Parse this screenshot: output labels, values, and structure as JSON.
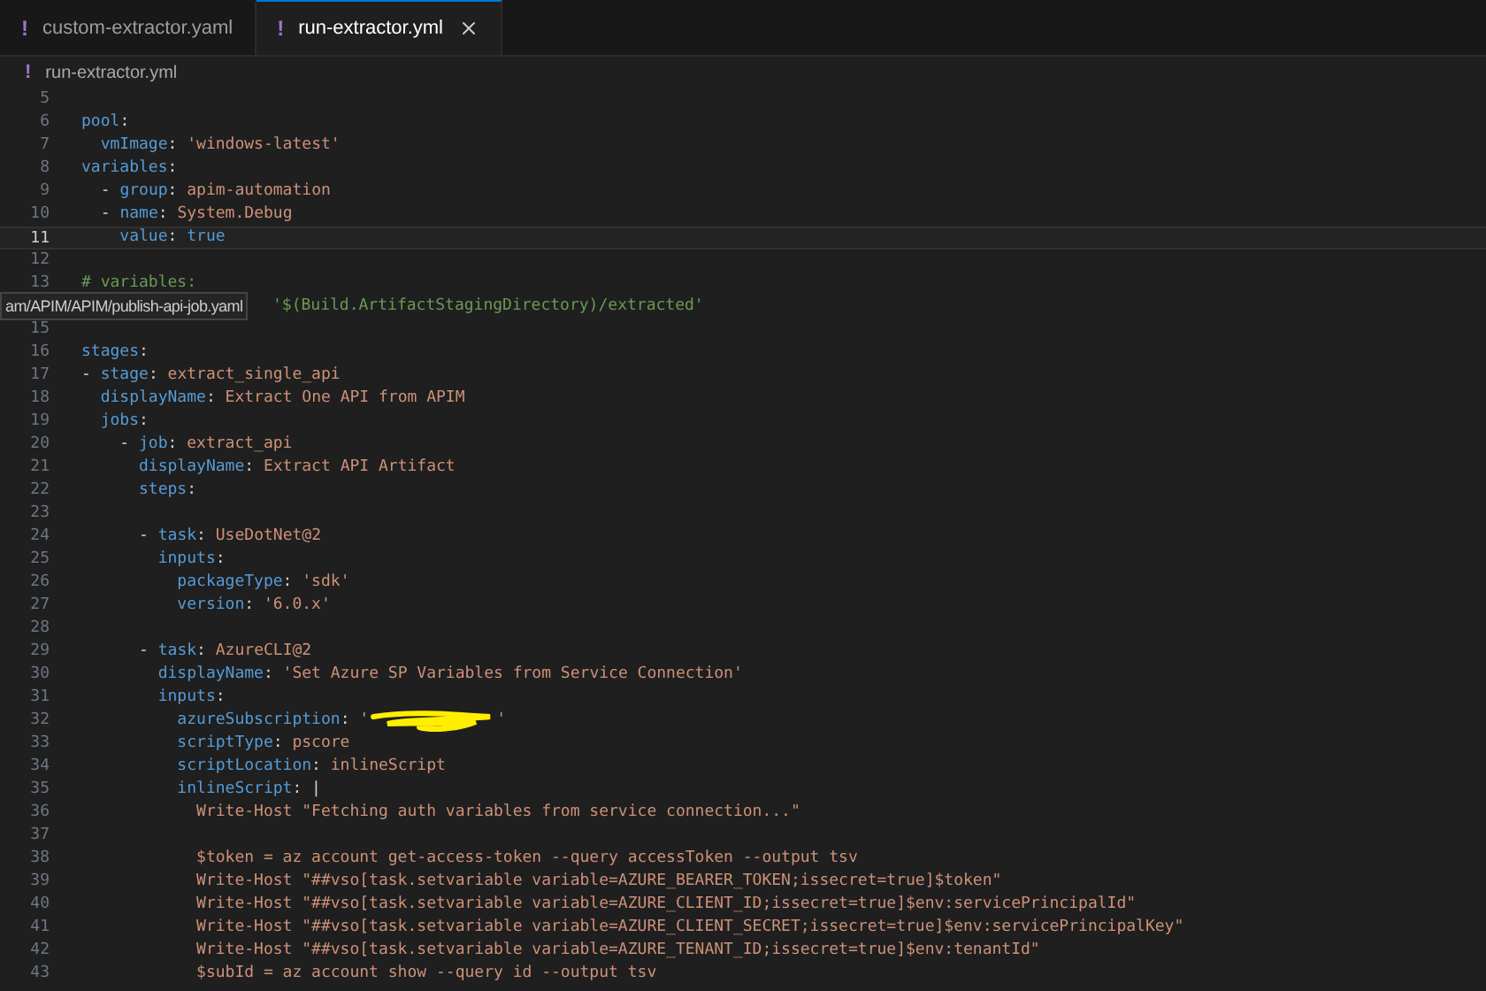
{
  "tabs": [
    {
      "icon": "!",
      "label": "custom-extractor.yaml",
      "selected": false
    },
    {
      "icon": "!",
      "label": "run-extractor.yml",
      "selected": true
    }
  ],
  "breadcrumb": {
    "icon": "!",
    "label": "run-extractor.yml"
  },
  "tooltip": "am/APIM/APIM/publish-api-job.yaml",
  "lines": [
    {
      "n": "5",
      "current": false
    },
    {
      "n": "6",
      "current": false,
      "tokens": [
        {
          "kind": "key",
          "text": "pool"
        },
        {
          "kind": "plain",
          "text": ":"
        }
      ]
    },
    {
      "n": "7",
      "current": false,
      "tokens": [
        {
          "kind": "key",
          "text": "  vmImage"
        },
        {
          "kind": "plain",
          "text": ": "
        },
        {
          "kind": "str",
          "text": "'windows-latest'"
        }
      ]
    },
    {
      "n": "8",
      "current": false,
      "tokens": [
        {
          "kind": "key",
          "text": "variables"
        },
        {
          "kind": "plain",
          "text": ":"
        }
      ]
    },
    {
      "n": "9",
      "current": false,
      "tokens": [
        {
          "kind": "plain",
          "text": "  - "
        },
        {
          "kind": "key",
          "text": "group"
        },
        {
          "kind": "plain",
          "text": ": "
        },
        {
          "kind": "str",
          "text": "apim-automation"
        }
      ]
    },
    {
      "n": "10",
      "current": false,
      "tokens": [
        {
          "kind": "plain",
          "text": "  - "
        },
        {
          "kind": "key",
          "text": "name"
        },
        {
          "kind": "plain",
          "text": ": "
        },
        {
          "kind": "str",
          "text": "System.Debug"
        }
      ]
    },
    {
      "n": "11",
      "current": true,
      "tokens": [
        {
          "kind": "key",
          "text": "    value"
        },
        {
          "kind": "plain",
          "text": ": "
        },
        {
          "kind": "bool",
          "text": "true"
        }
      ]
    },
    {
      "n": "12",
      "current": false
    },
    {
      "n": "13",
      "current": false,
      "tokens": [
        {
          "kind": "comment",
          "text": "# variables:"
        }
      ]
    },
    {
      "current": false,
      "covered": true,
      "tokens": [
        {
          "kind": "comment",
          "text": "'$(Build.ArtifactStagingDirectory)/extracted'"
        }
      ]
    },
    {
      "n": "15",
      "current": false
    },
    {
      "n": "16",
      "current": false,
      "tokens": [
        {
          "kind": "key",
          "text": "stages"
        },
        {
          "kind": "plain",
          "text": ":"
        }
      ]
    },
    {
      "n": "17",
      "current": false,
      "tokens": [
        {
          "kind": "plain",
          "text": "- "
        },
        {
          "kind": "key",
          "text": "stage"
        },
        {
          "kind": "plain",
          "text": ": "
        },
        {
          "kind": "str",
          "text": "extract_single_api"
        }
      ]
    },
    {
      "n": "18",
      "current": false,
      "tokens": [
        {
          "kind": "key",
          "text": "  displayName"
        },
        {
          "kind": "plain",
          "text": ": "
        },
        {
          "kind": "str",
          "text": "Extract One API from APIM"
        }
      ]
    },
    {
      "n": "19",
      "current": false,
      "tokens": [
        {
          "kind": "key",
          "text": "  jobs"
        },
        {
          "kind": "plain",
          "text": ":"
        }
      ]
    },
    {
      "n": "20",
      "current": false,
      "tokens": [
        {
          "kind": "plain",
          "text": "    - "
        },
        {
          "kind": "key",
          "text": "job"
        },
        {
          "kind": "plain",
          "text": ": "
        },
        {
          "kind": "str",
          "text": "extract_api"
        }
      ]
    },
    {
      "n": "21",
      "current": false,
      "tokens": [
        {
          "kind": "key",
          "text": "      displayName"
        },
        {
          "kind": "plain",
          "text": ": "
        },
        {
          "kind": "str",
          "text": "Extract API Artifact"
        }
      ]
    },
    {
      "n": "22",
      "current": false,
      "tokens": [
        {
          "kind": "key",
          "text": "      steps"
        },
        {
          "kind": "plain",
          "text": ":"
        }
      ]
    },
    {
      "n": "23",
      "current": false
    },
    {
      "n": "24",
      "current": false,
      "tokens": [
        {
          "kind": "plain",
          "text": "      - "
        },
        {
          "kind": "key",
          "text": "task"
        },
        {
          "kind": "plain",
          "text": ": "
        },
        {
          "kind": "str",
          "text": "UseDotNet@2"
        }
      ]
    },
    {
      "n": "25",
      "current": false,
      "tokens": [
        {
          "kind": "key",
          "text": "        inputs"
        },
        {
          "kind": "plain",
          "text": ":"
        }
      ]
    },
    {
      "n": "26",
      "current": false,
      "tokens": [
        {
          "kind": "key",
          "text": "          packageType"
        },
        {
          "kind": "plain",
          "text": ": "
        },
        {
          "kind": "str",
          "text": "'sdk'"
        }
      ]
    },
    {
      "n": "27",
      "current": false,
      "tokens": [
        {
          "kind": "key",
          "text": "          version"
        },
        {
          "kind": "plain",
          "text": ": "
        },
        {
          "kind": "str",
          "text": "'6.0.x'"
        }
      ]
    },
    {
      "n": "28",
      "current": false
    },
    {
      "n": "29",
      "current": false,
      "tokens": [
        {
          "kind": "plain",
          "text": "      - "
        },
        {
          "kind": "key",
          "text": "task"
        },
        {
          "kind": "plain",
          "text": ": "
        },
        {
          "kind": "str",
          "text": "AzureCLI@2"
        }
      ]
    },
    {
      "n": "30",
      "current": false,
      "tokens": [
        {
          "kind": "key",
          "text": "        displayName"
        },
        {
          "kind": "plain",
          "text": ": "
        },
        {
          "kind": "str",
          "text": "'Set Azure SP Variables from Service Connection'"
        }
      ]
    },
    {
      "n": "31",
      "current": false,
      "tokens": [
        {
          "kind": "key",
          "text": "        inputs"
        },
        {
          "kind": "plain",
          "text": ":"
        }
      ]
    },
    {
      "n": "32",
      "current": false,
      "tokens": [
        {
          "kind": "key",
          "text": "          azureSubscription"
        },
        {
          "kind": "plain",
          "text": ": "
        },
        {
          "kind": "str",
          "text": "'"
        },
        {
          "kind": "redaction"
        },
        {
          "kind": "str",
          "text": "'"
        }
      ]
    },
    {
      "n": "33",
      "current": false,
      "tokens": [
        {
          "kind": "key",
          "text": "          scriptType"
        },
        {
          "kind": "plain",
          "text": ": "
        },
        {
          "kind": "str",
          "text": "pscore"
        }
      ]
    },
    {
      "n": "34",
      "current": false,
      "tokens": [
        {
          "kind": "key",
          "text": "          scriptLocation"
        },
        {
          "kind": "plain",
          "text": ": "
        },
        {
          "kind": "str",
          "text": "inlineScript"
        }
      ]
    },
    {
      "n": "35",
      "current": false,
      "tokens": [
        {
          "kind": "key",
          "text": "          inlineScript"
        },
        {
          "kind": "plain",
          "text": ": |"
        }
      ]
    },
    {
      "n": "36",
      "current": false,
      "tokens": [
        {
          "kind": "str",
          "text": "            Write-Host \"Fetching auth variables from service connection...\""
        }
      ]
    },
    {
      "n": "37",
      "current": false
    },
    {
      "n": "38",
      "current": false,
      "tokens": [
        {
          "kind": "str",
          "text": "            $token = az account get-access-token --query accessToken --output tsv"
        }
      ]
    },
    {
      "n": "39",
      "current": false,
      "tokens": [
        {
          "kind": "str",
          "text": "            Write-Host \"##vso[task.setvariable variable=AZURE_BEARER_TOKEN;issecret=true]$token\""
        }
      ]
    },
    {
      "n": "40",
      "current": false,
      "tokens": [
        {
          "kind": "str",
          "text": "            Write-Host \"##vso[task.setvariable variable=AZURE_CLIENT_ID;issecret=true]$env:servicePrincipalId\""
        }
      ]
    },
    {
      "n": "41",
      "current": false,
      "tokens": [
        {
          "kind": "str",
          "text": "            Write-Host \"##vso[task.setvariable variable=AZURE_CLIENT_SECRET;issecret=true]$env:servicePrincipalKey\""
        }
      ]
    },
    {
      "n": "42",
      "current": false,
      "tokens": [
        {
          "kind": "str",
          "text": "            Write-Host \"##vso[task.setvariable variable=AZURE_TENANT_ID;issecret=true]$env:tenantId\""
        }
      ]
    },
    {
      "n": "43",
      "current": false,
      "tokens": [
        {
          "kind": "str",
          "text": "            $subId = az account show --query id --output tsv"
        }
      ]
    }
  ]
}
